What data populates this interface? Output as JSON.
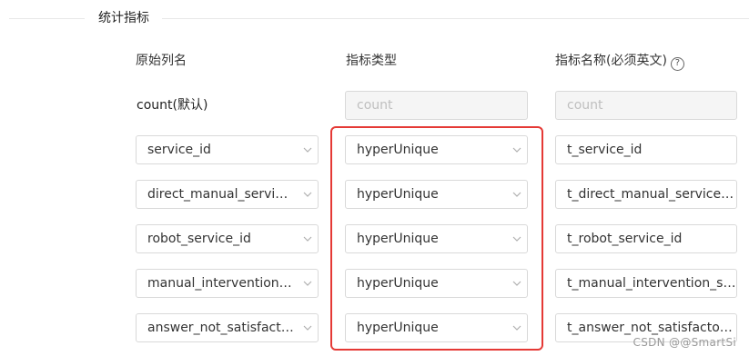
{
  "section": {
    "title": "统计指标"
  },
  "columns": {
    "source": "原始列名",
    "type": "指标类型",
    "name": "指标名称(必须英文)"
  },
  "default_row": {
    "source_label": "count(默认)",
    "type_placeholder": "count",
    "name_placeholder": "count"
  },
  "rows": [
    {
      "source": "service_id",
      "type": "hyperUnique",
      "name": "t_service_id"
    },
    {
      "source": "direct_manual_service...",
      "type": "hyperUnique",
      "name": "t_direct_manual_service_id"
    },
    {
      "source": "robot_service_id",
      "type": "hyperUnique",
      "name": "t_robot_service_id"
    },
    {
      "source": "manual_intervention_s...",
      "type": "hyperUnique",
      "name": "t_manual_intervention_servi"
    },
    {
      "source": "answer_not_satisfacto...",
      "type": "hyperUnique",
      "name": "t_answer_not_satisfactory_s"
    }
  ],
  "icons": {
    "help": "question-circle-icon",
    "dropdown": "chevron-down-icon"
  },
  "colors": {
    "highlight": "#e53935",
    "border": "#d9d9d9",
    "disabled_bg": "#f5f5f5"
  },
  "watermark": "CSDN @@SmartSi"
}
